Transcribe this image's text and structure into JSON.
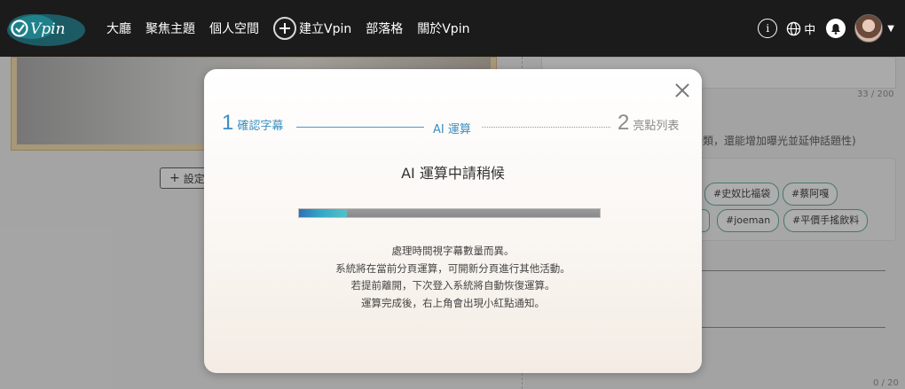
{
  "header": {
    "logo_text": "Vpin",
    "nav": [
      "大廳",
      "聚焦主題",
      "個人空間"
    ],
    "create_label": "建立Vpin",
    "nav_after": [
      "部落格",
      "關於Vpin"
    ],
    "info_icon": "i",
    "lang_label": "中"
  },
  "background": {
    "setup_button": "設定",
    "counter_top": "33 / 200",
    "hint_text": "分類，還能增加曝光並延伸話題性)",
    "tags": [
      "#史奴比福袋",
      "#蔡阿嘎",
      "#joeman",
      "#平價手搖飲料"
    ],
    "counter_bottom": "0 / 20"
  },
  "modal": {
    "steps": [
      {
        "num": "1",
        "label": "確認字幕"
      },
      {
        "num": "",
        "label": "AI 運算"
      },
      {
        "num": "2",
        "label": "亮點列表"
      }
    ],
    "title": "AI 運算中請稍候",
    "progress": 0.16,
    "lines": [
      "處理時間視字幕數量而異。",
      "系統將在當前分頁運算，可開新分頁進行其他活動。",
      "若提前離開，下次登入系統將自動恢復運算。",
      "運算完成後，右上角會出現小紅點通知。"
    ]
  },
  "colors": {
    "accent": "#3b8fc0",
    "tag_border": "#5aa89c",
    "topbar": "#1b1b1b"
  }
}
